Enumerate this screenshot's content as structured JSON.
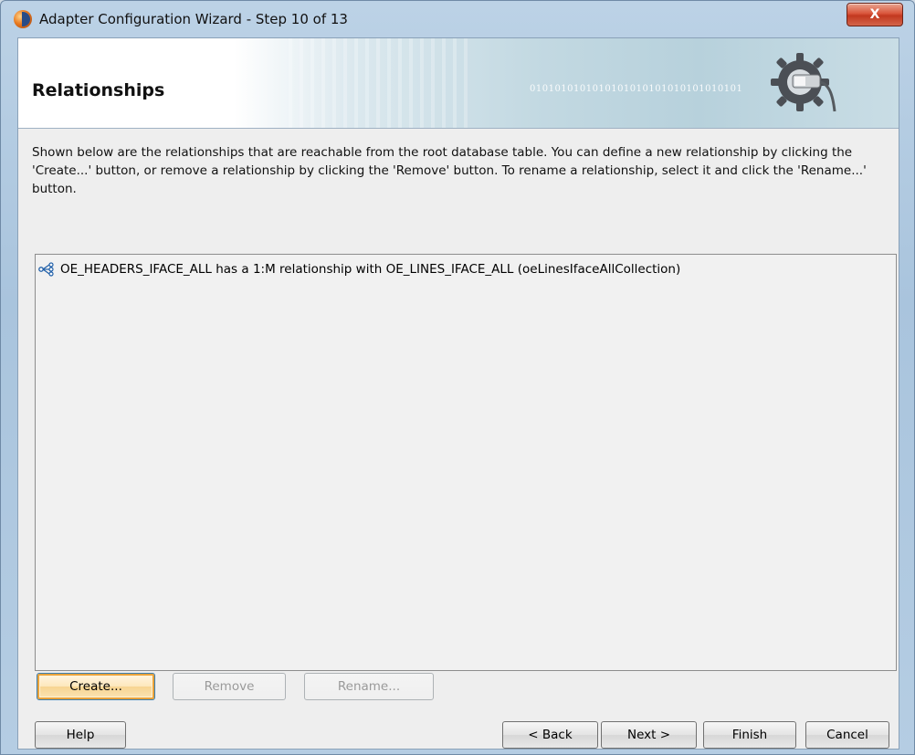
{
  "window": {
    "title": "Adapter Configuration Wizard - Step 10 of 13",
    "close_label": "X"
  },
  "banner": {
    "title": "Relationships",
    "binary_text": "0101010101010101010101010101010101"
  },
  "description": "Shown below are the relationships that are reachable from the root database table.  You can define a new relationship by clicking the 'Create...' button, or remove a relationship by clicking the 'Remove' button.  To rename a relationship, select it and click the 'Rename...' button.",
  "relationships": [
    {
      "label": "OE_HEADERS_IFACE_ALL has a 1:M relationship with OE_LINES_IFACE_ALL (oeLinesIfaceAllCollection)",
      "icon": "relationship-icon"
    }
  ],
  "list_actions": {
    "create_label": "Create...",
    "remove_label": "Remove",
    "rename_label": "Rename..."
  },
  "footer": {
    "help_label": "Help",
    "back_label": "< Back",
    "next_label": "Next >",
    "finish_label": "Finish",
    "cancel_label": "Cancel"
  },
  "colors": {
    "focus_accent": "#e9a23a",
    "close_button": "#d9553b"
  }
}
